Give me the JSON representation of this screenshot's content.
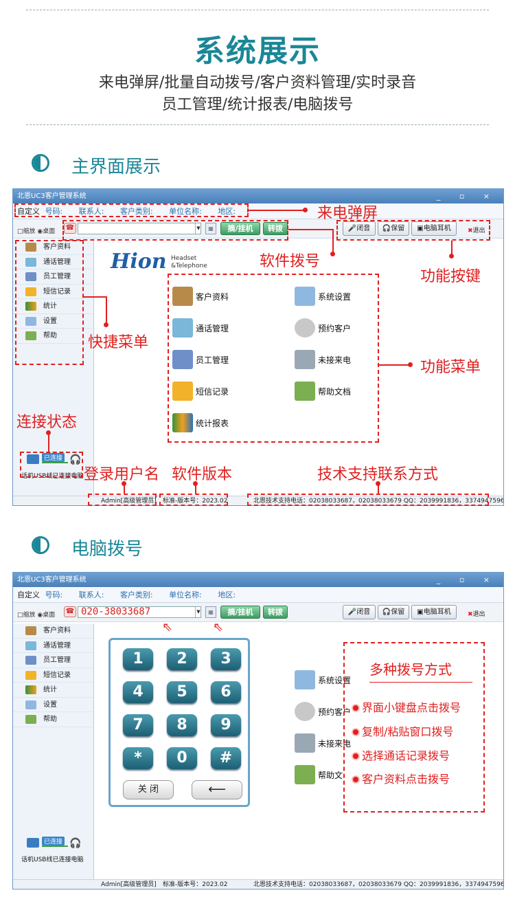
{
  "hero": {
    "title": "系统展示",
    "subtitle_1": "来电弹屏/批量自动拨号/客户资料管理/实时录音",
    "subtitle_2": "员工管理/统计报表/电脑拨号"
  },
  "sections": {
    "main": "主界面展示",
    "dial": "电脑拨号"
  },
  "app": {
    "title": "北恩UC3客户管理系统",
    "win_controls": "_ ▫ ×",
    "infobar": {
      "custom": "自定义",
      "number": "号码:",
      "contact": "联系人:",
      "category": "客户类别:",
      "company": "单位名称:",
      "region": "地区:"
    },
    "toolbar": {
      "view": "□缩放 ◉桌面",
      "pickup": "摘/挂机",
      "transfer": "转拨",
      "mute": "闭音",
      "hold": "保留",
      "pc_headset": "电脑耳机",
      "exit": "退出",
      "dial_value": "020-38033687"
    },
    "sidebar": [
      "客户资料",
      "通话管理",
      "员工管理",
      "短信记录",
      "统计",
      "设置",
      "帮助"
    ],
    "status": {
      "connected": "已连接",
      "text": "话机USB线已连接电脑"
    },
    "logo": {
      "brand": "Hion",
      "sub_1": "Headset",
      "sub_2": "&Telephone"
    },
    "features": [
      "客户资料",
      "系统设置",
      "通话管理",
      "预约客户",
      "员工管理",
      "未接来电",
      "短信记录",
      "帮助文档",
      "统计报表"
    ],
    "dial_features": [
      "系统设置",
      "预约客户",
      "未接来电",
      "帮助文"
    ],
    "footer": {
      "user": "Admin[高级管理员]",
      "version": "标准-版本号：2023.02",
      "support": "北恩技术支持电话：02038033687，02038033679 QQ：2039991836，3374947596"
    }
  },
  "annotations": {
    "popup": "来电弹屏",
    "dialing": "软件拨号",
    "func_keys": "功能按键",
    "quick_menu": "快捷菜单",
    "func_menu": "功能菜单",
    "conn_status": "连接状态",
    "login_user": "登录用户名",
    "sw_version": "软件版本",
    "support": "技术支持联系方式"
  },
  "keypad": {
    "keys": [
      "1",
      "2",
      "3",
      "4",
      "5",
      "6",
      "7",
      "8",
      "9",
      "*",
      "0",
      "#"
    ],
    "close": "关 闭",
    "back": "⟵"
  },
  "dial_methods": {
    "title": "多种拨号方式",
    "items": [
      "界面小键盘点击拨号",
      "复制/粘贴窗口拨号",
      "选择通话记录拨号",
      "客户资料点击拨号"
    ]
  },
  "icons": {
    "search": "phone-icon",
    "colors": {
      "accent": "#1a8797",
      "annotation": "#e02020",
      "title_bar": "#4a7fb8"
    }
  }
}
